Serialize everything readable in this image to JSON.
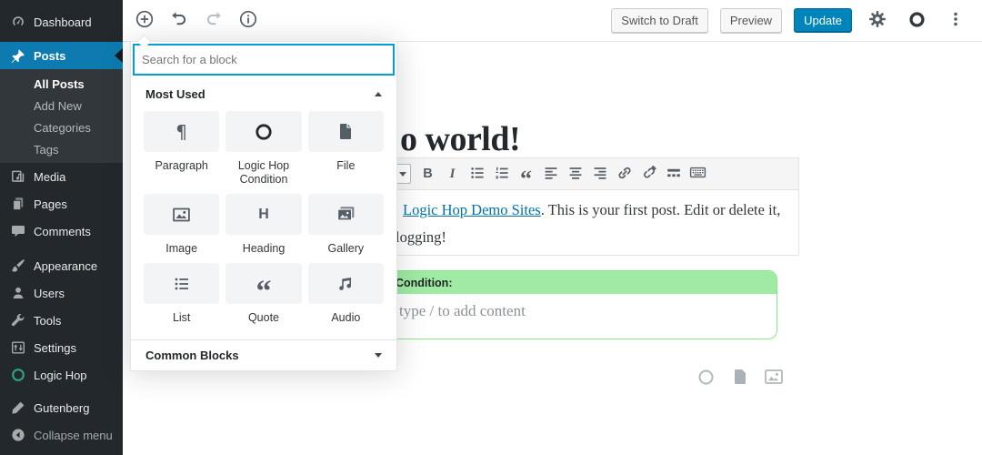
{
  "sidebar": {
    "items": [
      {
        "label": "Dashboard"
      },
      {
        "label": "Posts",
        "active": true
      },
      {
        "label": "Media"
      },
      {
        "label": "Pages"
      },
      {
        "label": "Comments"
      },
      {
        "label": "Appearance"
      },
      {
        "label": "Users"
      },
      {
        "label": "Tools"
      },
      {
        "label": "Settings"
      },
      {
        "label": "Logic Hop"
      },
      {
        "label": "Gutenberg"
      },
      {
        "label": "Collapse menu"
      }
    ],
    "posts_submenu": [
      {
        "label": "All Posts",
        "current": true
      },
      {
        "label": "Add New"
      },
      {
        "label": "Categories"
      },
      {
        "label": "Tags"
      }
    ]
  },
  "topbar": {
    "switch_to_draft": "Switch to Draft",
    "preview": "Preview",
    "update": "Update"
  },
  "inserter": {
    "search_placeholder": "Search for a block",
    "most_used_label": "Most Used",
    "common_blocks_label": "Common Blocks",
    "blocks": [
      "Paragraph",
      "Logic Hop Condition",
      "File",
      "Image",
      "Heading",
      "Gallery",
      "List",
      "Quote",
      "Audio"
    ]
  },
  "editor": {
    "title_visible": "o world!",
    "paragraph": {
      "link_text": "Logic Hop Demo Sites",
      "line1_rest": ". This is your first post. Edit or delete it,",
      "line2": "logging!"
    },
    "condition": {
      "header": "Condition:",
      "placeholder": "type / to add content"
    }
  },
  "icons": {
    "paragraph": "¶",
    "heading": "H",
    "quote": "“",
    "bold": "B",
    "italic": "I"
  },
  "colors": {
    "accent_primary": "#0085ba",
    "menu_active": "#0e7bb0",
    "focus_blue": "#00a0d2",
    "link": "#0073aa",
    "condition_green": "#a0eba3",
    "sidebar_bg": "#23282d",
    "logic_hop_teal": "#2ea186"
  }
}
